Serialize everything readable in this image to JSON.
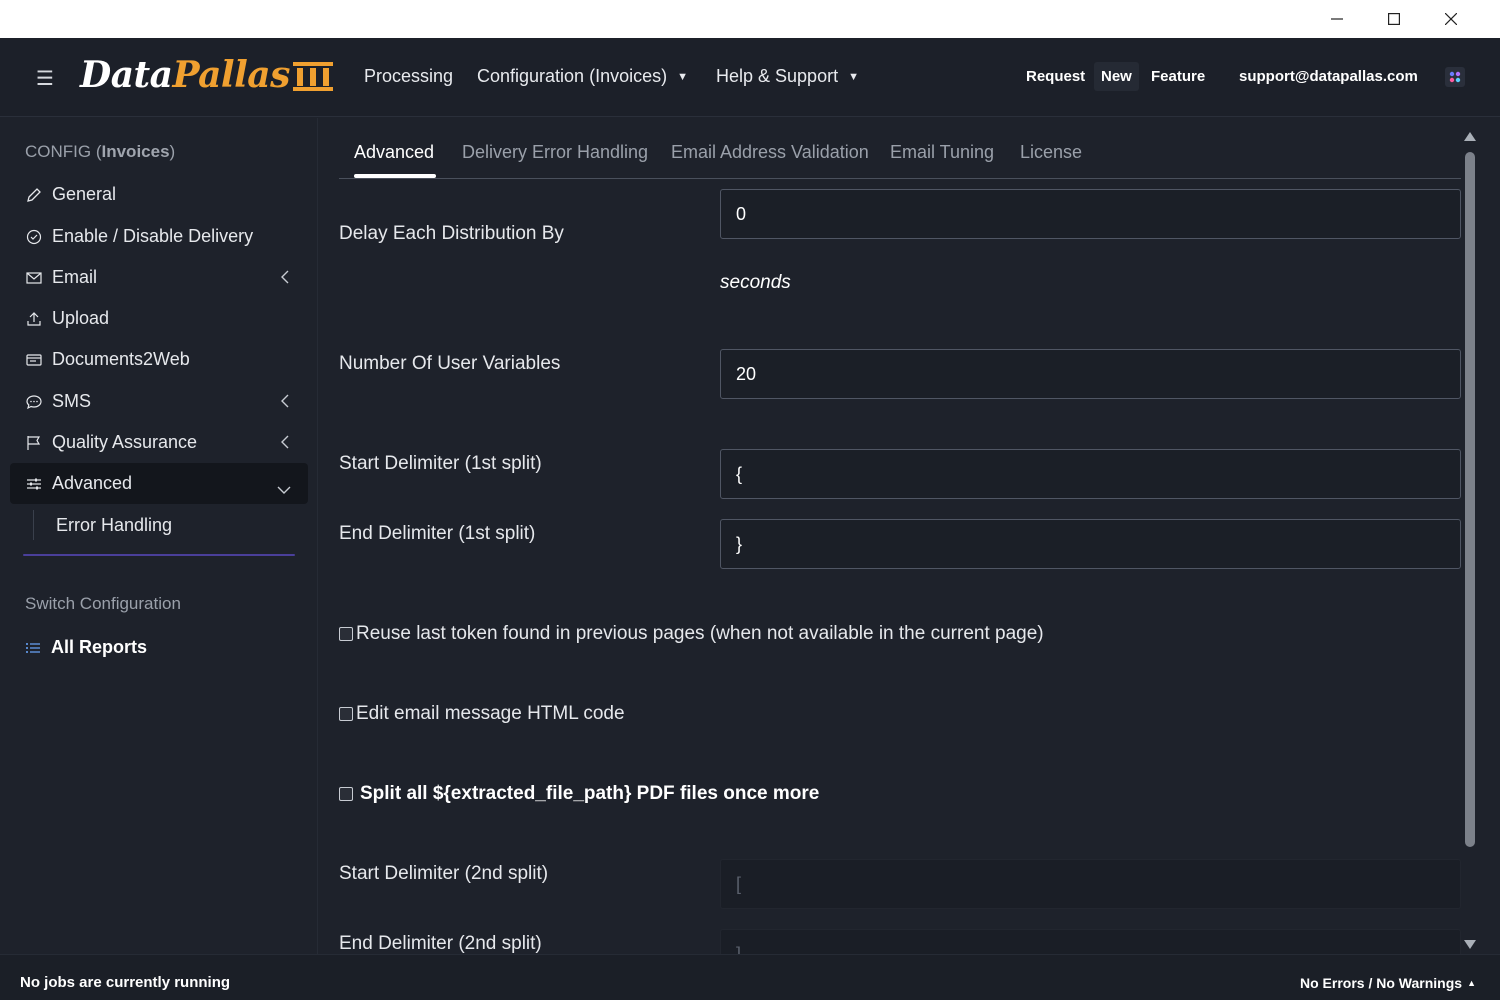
{
  "header": {
    "logo_part1": "Data",
    "logo_part2": "Pallas",
    "nav": {
      "processing": "Processing",
      "configuration": "Configuration (Invoices)",
      "help": "Help & Support"
    },
    "links": {
      "request": "Request",
      "new": "New",
      "feature": "Feature",
      "email": "support@datapallas.com"
    },
    "caret": "▼"
  },
  "sidebar": {
    "title_prefix": "CONFIG (",
    "title_bold": "Invoices",
    "title_suffix": ")",
    "items": [
      {
        "label": "General"
      },
      {
        "label": "Enable / Disable Delivery"
      },
      {
        "label": "Email"
      },
      {
        "label": "Upload"
      },
      {
        "label": "Documents2Web"
      },
      {
        "label": "SMS"
      },
      {
        "label": "Quality Assurance"
      },
      {
        "label": "Advanced"
      }
    ],
    "sub_item": "Error Handling",
    "switch_title": "Switch Configuration",
    "all_reports": "All Reports"
  },
  "tabs": [
    {
      "label": "Advanced",
      "active": true
    },
    {
      "label": "Delivery Error Handling"
    },
    {
      "label": "Email Address Validation"
    },
    {
      "label": "Email Tuning"
    },
    {
      "label": "License"
    }
  ],
  "form": {
    "delay_label": "Delay Each Distribution By",
    "delay_value": "0",
    "delay_units": "seconds",
    "user_vars_label": "Number Of User Variables",
    "user_vars_value": "20",
    "start_delim1_label": "Start Delimiter (1st split)",
    "start_delim1_value": "{",
    "end_delim1_label": "End Delimiter (1st split)",
    "end_delim1_value": "}",
    "reuse_token_label": "Reuse last token found in previous pages (when not available in the current page)",
    "edit_html_label": "Edit email message HTML code",
    "split_again_label": "Split all ${extracted_file_path} PDF files once more",
    "start_delim2_label": "Start Delimiter (2nd split)",
    "start_delim2_value": "[",
    "end_delim2_label": "End Delimiter (2nd split)",
    "end_delim2_value": "]"
  },
  "status": {
    "left": "No jobs are currently running",
    "right": "No Errors / No Warnings",
    "caret": "▲"
  },
  "colors": {
    "accent_orange": "#f0a030",
    "background": "#1e222b",
    "divider_purple": "#4a3f9a"
  }
}
